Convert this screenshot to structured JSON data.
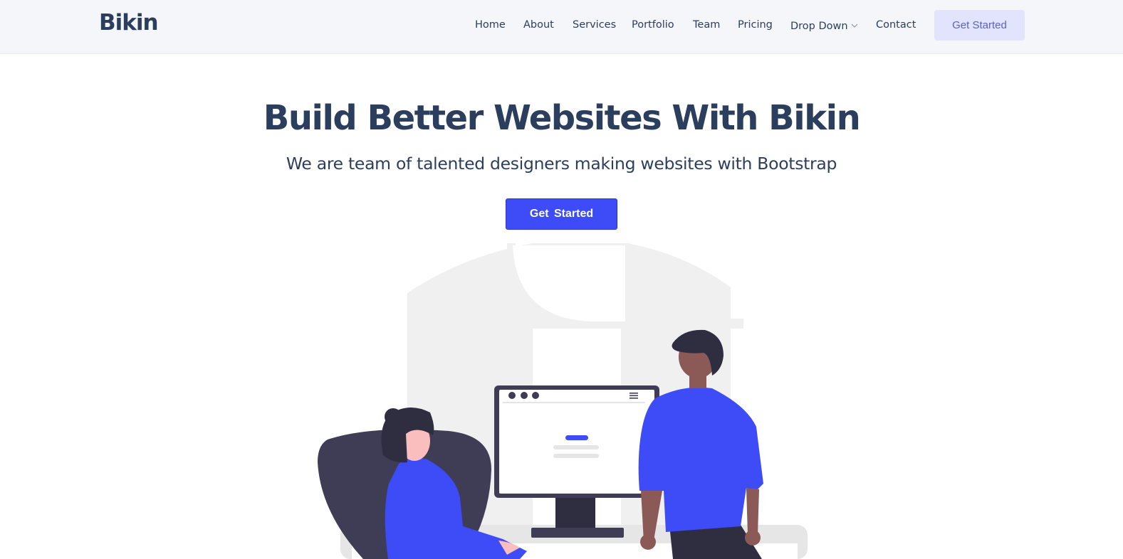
{
  "header": {
    "logo": "Bikin",
    "nav": {
      "home": "Home",
      "about": "About",
      "services": "Services",
      "portfolio": "Portfolio",
      "team": "Team",
      "pricing": "Pricing",
      "dropdown": "Drop Down",
      "contact": "Contact"
    },
    "cta_label": "Get Started"
  },
  "hero": {
    "title": "Build Better Websites With Bikin",
    "subtitle": "We are team of talented designers making websites with Bootstrap",
    "cta_label": "Get  Started"
  },
  "colors": {
    "accent": "#3d4cf6",
    "text": "#2c3e5d",
    "header_bg": "#f4f6f9",
    "nav_button_bg": "#e2e4fd",
    "dark_figure": "#3f3d56"
  },
  "icons": {
    "dropdown": "chevron-down-icon",
    "menu": "hamburger-icon"
  }
}
